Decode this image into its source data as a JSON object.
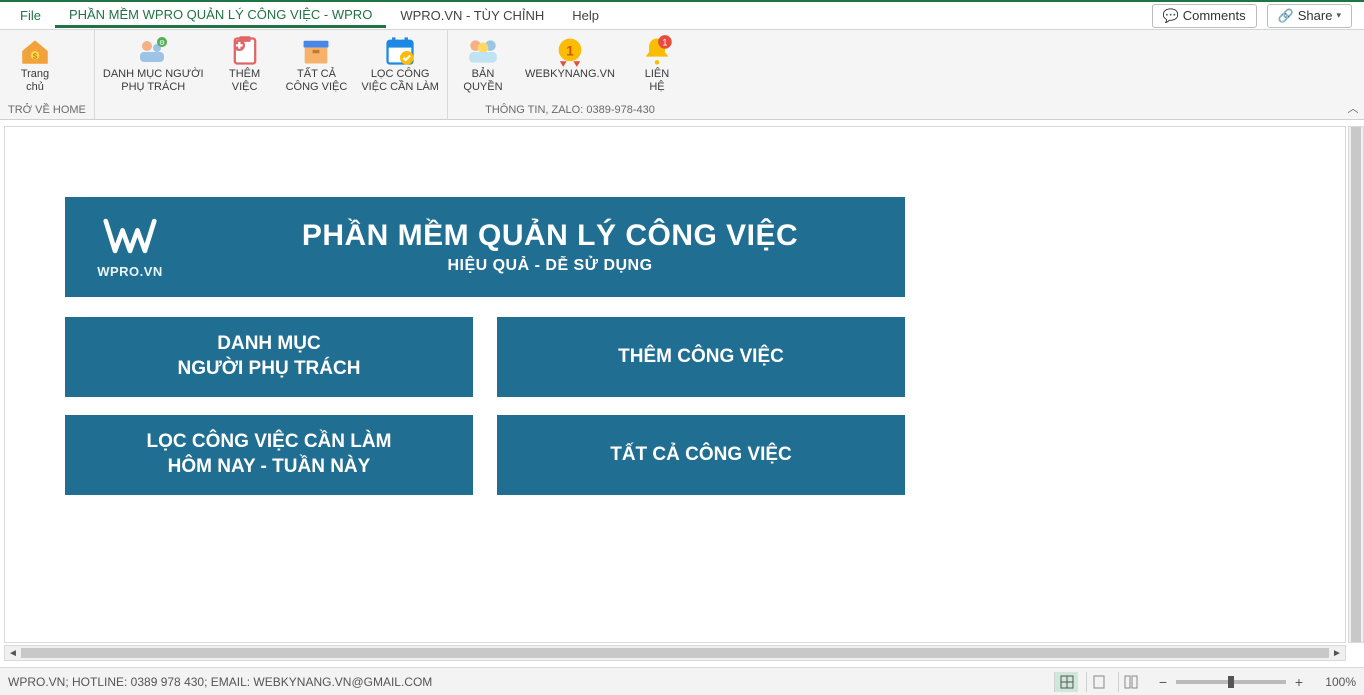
{
  "tabs": {
    "file": "File",
    "active": "PHẦN MỀM WPRO QUẢN LÝ CÔNG VIỆC - WPRO",
    "customize": "WPRO.VN - TÙY CHỈNH",
    "help": "Help"
  },
  "header_buttons": {
    "comments": "Comments",
    "share": "Share"
  },
  "ribbon": {
    "group1": {
      "home": "Trang\nchủ",
      "label": "TRỞ VỀ HOME"
    },
    "group2": {
      "contacts": "DANH MỤC NGƯỜI\nPHỤ TRÁCH",
      "add": "THÊM\nVIỆC",
      "all": "TẤT CẢ\nCÔNG VIỆC",
      "filter": "LỌC CÔNG\nVIỆC CẦN LÀM"
    },
    "group3": {
      "license": "BẢN\nQUYỀN",
      "web": "WEBKYNANG.VN",
      "contact": "LIÊN\nHỆ",
      "label": "THÔNG TIN, ZALO: 0389-978-430"
    }
  },
  "banner": {
    "brand": "WPRO.VN",
    "title": "PHẦN MỀM QUẢN LÝ CÔNG VIỆC",
    "subtitle": "HIỆU QUẢ - DỄ SỬ DỤNG"
  },
  "cards": {
    "c1": "DANH MỤC\nNGƯỜI PHỤ TRÁCH",
    "c2": "THÊM CÔNG VIỆC",
    "c3": "LỌC CÔNG VIỆC CẦN LÀM\nHÔM NAY - TUẦN NÀY",
    "c4": "TẤT CẢ CÔNG VIỆC"
  },
  "statusbar": {
    "text": "WPRO.VN; HOTLINE: 0389 978 430; EMAIL: WEBKYNANG.VN@GMAIL.COM",
    "zoom": "100%"
  }
}
